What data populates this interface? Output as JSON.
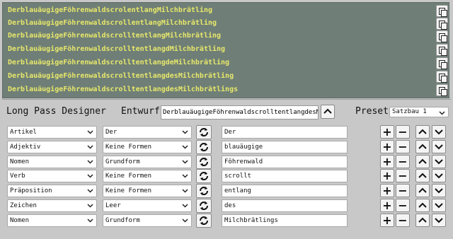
{
  "outputs": [
    "DerblauäugigeFöhrenwaldscrolentlangMilchbrätling",
    "DerblauäugigeFöhrenwaldscrollentlangMilchbrätling",
    "DerblauäugigeFöhrenwaldscrolltentlangMilchbrätling",
    "DerblauäugigeFöhrenwaldscrolltentlangdMilchbrätling",
    "DerblauäugigeFöhrenwaldscrolltentlangdeMilchbrätling",
    "DerblauäugigeFöhrenwaldscrolltentlangdesMilchbrätling",
    "DerblauäugigeFöhrenwaldscrolltentlangdesMilchbrätlings"
  ],
  "designer": {
    "title": "Long Pass Designer",
    "entwurf_label": "Entwurf",
    "entwurf_value": "DerblauäugigeFöhrenwaldscrolltentlangdesMilchbrätl",
    "preset_label": "Preset",
    "preset_value": "Satzbau 1"
  },
  "rows": [
    {
      "type": "Artikel",
      "form": "Der",
      "word": "Der"
    },
    {
      "type": "Adjektiv",
      "form": "Keine Formen",
      "word": "blauäugige"
    },
    {
      "type": "Nomen",
      "form": "Grundform",
      "word": "Föhrenwald"
    },
    {
      "type": "Verb",
      "form": "Keine Formen",
      "word": "scrollt"
    },
    {
      "type": "Präposition",
      "form": "Keine Formen",
      "word": "entlang"
    },
    {
      "type": "Zeichen",
      "form": "Leer",
      "word": "des"
    },
    {
      "type": "Nomen",
      "form": "Grundform",
      "word": "Milchbrätlings"
    }
  ],
  "icons": {
    "copy": "copy-icon",
    "refresh": "refresh-icon",
    "plus": "+",
    "minus": "−",
    "up": "chevron-up-icon",
    "down": "chevron-down-icon",
    "entwurf_up": "chevron-up-icon"
  },
  "colors": {
    "output_bg": "#6f7f77",
    "output_text": "#e8e86a",
    "page_bg": "#c8c8c8"
  }
}
